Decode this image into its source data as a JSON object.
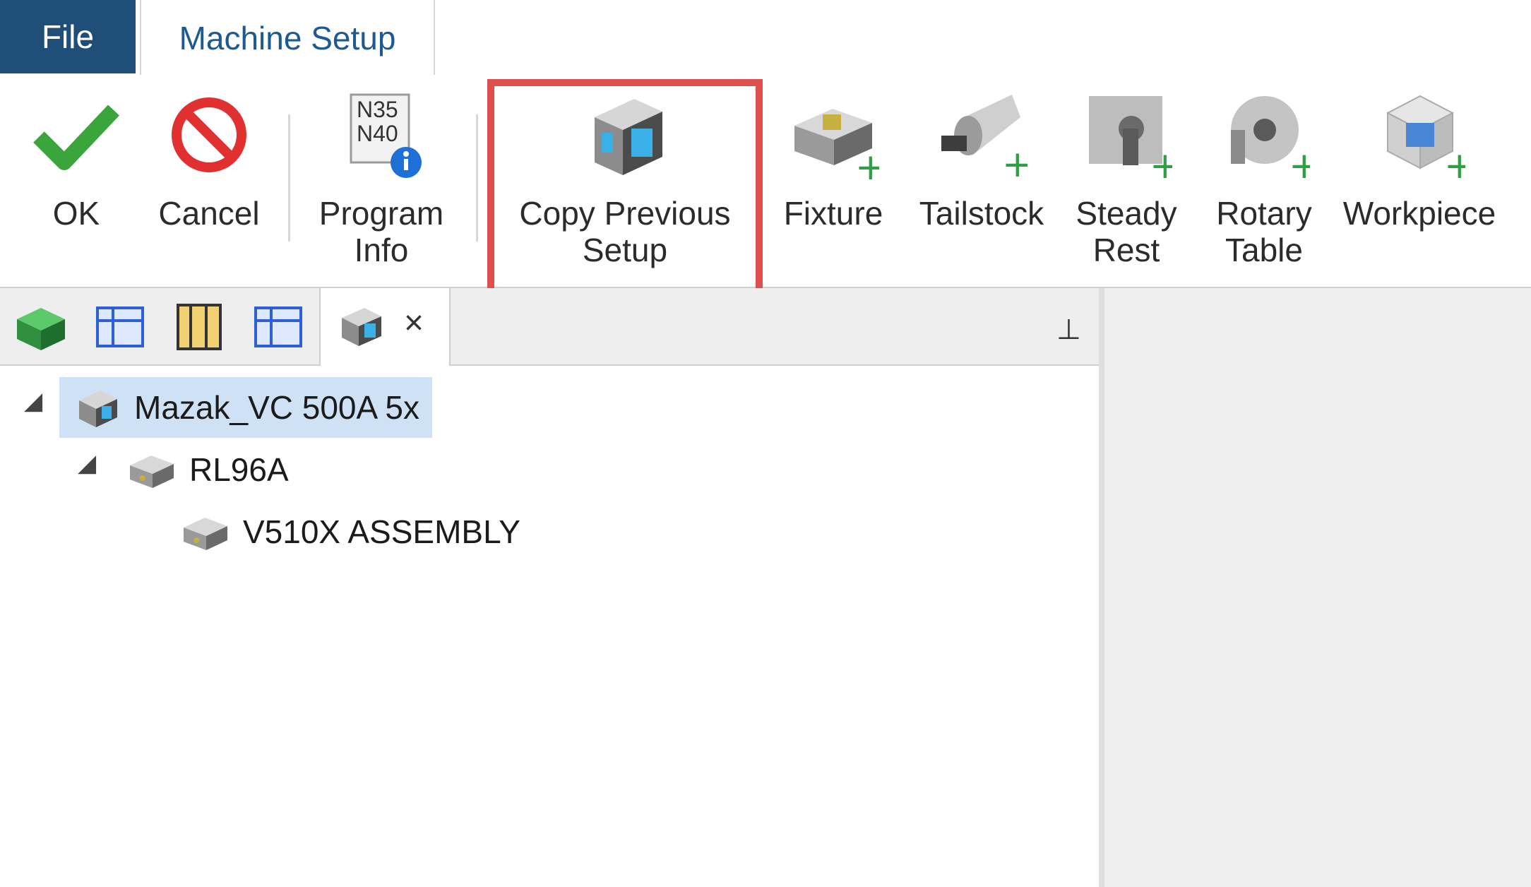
{
  "tabs": {
    "file": "File",
    "machine_setup": "Machine Setup"
  },
  "ribbon": {
    "ok": "OK",
    "cancel": "Cancel",
    "program_info": "Program\nInfo",
    "program_info_code_line1": "N35",
    "program_info_code_line2": "N40",
    "copy_previous_setup": "Copy Previous\nSetup",
    "fixture": "Fixture",
    "tailstock": "Tailstock",
    "steady_rest": "Steady\nRest",
    "rotary_table": "Rotary\nTable",
    "workpiece": "Workpiece"
  },
  "panel": {
    "close": "×",
    "pin": "⊥"
  },
  "tree": {
    "root": "Mazak_VC 500A 5x",
    "child": "RL96A",
    "grandchild": "V510X ASSEMBLY"
  },
  "colors": {
    "file_tab_bg": "#1f4e79",
    "tab_text": "#1e5a92",
    "highlight": "#e04e4e",
    "selected_row": "#cfe2f5",
    "plus_green": "#2ea043"
  }
}
